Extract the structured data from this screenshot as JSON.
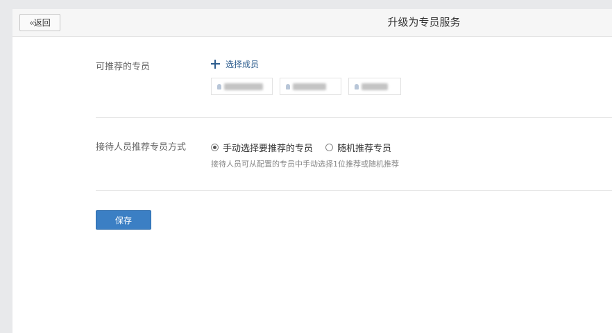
{
  "header": {
    "back_label": "返回",
    "title": "升级为专员服务"
  },
  "recommend": {
    "label": "可推荐的专员",
    "add_label": "选择成员",
    "members": [
      "",
      "",
      ""
    ]
  },
  "method": {
    "label": "接待人员推荐专员方式",
    "options": [
      {
        "label": "手动选择要推荐的专员",
        "checked": true
      },
      {
        "label": "随机推荐专员",
        "checked": false
      }
    ],
    "hint": "接待人员可从配置的专员中手动选择1位推荐或随机推荐"
  },
  "save_label": "保存",
  "colors": {
    "primary": "#3b7fc4",
    "link": "#2d5d8e",
    "background": "#e8e9eb"
  }
}
